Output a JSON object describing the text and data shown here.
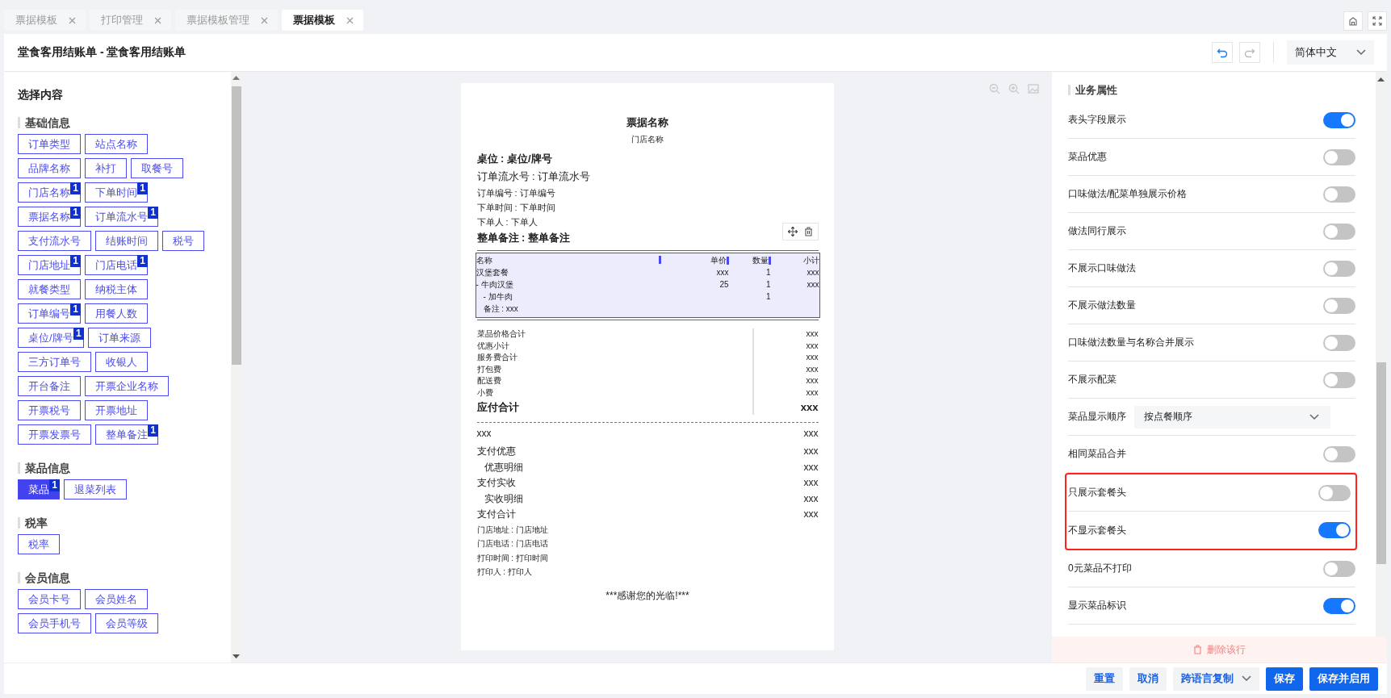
{
  "tabs": [
    {
      "label": "票据模板",
      "selected": false
    },
    {
      "label": "打印管理",
      "selected": false
    },
    {
      "label": "票据模板管理",
      "selected": false
    },
    {
      "label": "票据模板",
      "selected": true
    }
  ],
  "header": {
    "title": "堂食客用结账单 - 堂食客用结账单",
    "language": "简体中文"
  },
  "content_panel": {
    "title": "选择内容",
    "groups": [
      {
        "title": "基础信息",
        "tags": [
          {
            "label": "订单类型",
            "selected": false
          },
          {
            "label": "站点名称",
            "selected": false
          },
          {
            "label": "品牌名称",
            "selected": false
          },
          {
            "label": "补打",
            "selected": false
          },
          {
            "label": "取餐号",
            "selected": false
          },
          {
            "label": "门店名称",
            "badge": "1",
            "selected": false
          },
          {
            "label": "下单时间",
            "badge": "1",
            "selected": false
          },
          {
            "label": "票据名称",
            "badge": "1",
            "selected": false
          },
          {
            "label": "订单流水号",
            "badge": "1",
            "selected": false
          },
          {
            "label": "支付流水号",
            "selected": false
          },
          {
            "label": "结账时间",
            "selected": false
          },
          {
            "label": "税号",
            "selected": false
          },
          {
            "label": "门店地址",
            "badge": "1",
            "selected": false
          },
          {
            "label": "门店电话",
            "badge": "1",
            "selected": false
          },
          {
            "label": "就餐类型",
            "selected": false
          },
          {
            "label": "纳税主体",
            "selected": false
          },
          {
            "label": "订单编号",
            "badge": "1",
            "selected": false
          },
          {
            "label": "用餐人数",
            "selected": false
          },
          {
            "label": "桌位/牌号",
            "badge": "1",
            "selected": false
          },
          {
            "label": "订单来源",
            "selected": false
          },
          {
            "label": "三方订单号",
            "selected": false
          },
          {
            "label": "收银人",
            "selected": false
          },
          {
            "label": "开台备注",
            "selected": false
          },
          {
            "label": "开票企业名称",
            "selected": false
          },
          {
            "label": "开票税号",
            "selected": false
          },
          {
            "label": "开票地址",
            "selected": false
          },
          {
            "label": "开票发票号",
            "selected": false
          },
          {
            "label": "整单备注",
            "badge": "1",
            "selected": false
          }
        ]
      },
      {
        "title": "菜品信息",
        "tags": [
          {
            "label": "菜品",
            "badge": "1",
            "selected": true
          },
          {
            "label": "退菜列表",
            "selected": false
          }
        ]
      },
      {
        "title": "税率",
        "tags": [
          {
            "label": "税率",
            "selected": false
          }
        ]
      },
      {
        "title": "会员信息",
        "tags": [
          {
            "label": "会员卡号",
            "selected": false
          },
          {
            "label": "会员姓名",
            "selected": false
          },
          {
            "label": "会员手机号",
            "selected": false
          },
          {
            "label": "会员等级",
            "selected": false
          }
        ]
      }
    ]
  },
  "receipt": {
    "title": "票据名称",
    "store": "门店名称",
    "head_lines": [
      {
        "text": "桌位 : 桌位/牌号",
        "kind": "bold"
      },
      {
        "text": "订单流水号 : 订单流水号",
        "kind": "large"
      },
      {
        "text": "订单编号 : 订单编号",
        "kind": "small"
      },
      {
        "text": "下单时间 : 下单时间",
        "kind": "small"
      },
      {
        "text": "下单人 : 下单人",
        "kind": "small"
      },
      {
        "text": "整单备注 : 整单备注",
        "kind": "bold"
      }
    ],
    "items_table": {
      "selected": true,
      "columns": [
        "名称",
        "单价",
        "数量",
        "小计"
      ],
      "rows": [
        {
          "name": "汉堡套餐",
          "price": "xxx",
          "qty": "1",
          "subtotal": "xxx"
        },
        {
          "name": "- 牛肉汉堡",
          "price": "25",
          "qty": "1",
          "subtotal": "xxx",
          "children": [
            {
              "name": "- 加牛肉",
              "qty": "1"
            },
            {
              "name": "备注 : xxx"
            }
          ]
        }
      ]
    },
    "totals": [
      {
        "label": "菜品价格合计",
        "value": "xxx",
        "bold": false
      },
      {
        "label": "优惠小计",
        "value": "xxx",
        "bold": false
      },
      {
        "label": "服务费合计",
        "value": "xxx",
        "bold": false
      },
      {
        "label": "打包费",
        "value": "xxx",
        "bold": false
      },
      {
        "label": "配送费",
        "value": "xxx",
        "bold": false
      },
      {
        "label": "小费",
        "value": "xxx",
        "bold": false
      },
      {
        "label": "应付合计",
        "value": "xxx",
        "bold": true
      }
    ],
    "payments": [
      {
        "label": "xxx",
        "value": "xxx"
      },
      {
        "label": "支付优惠",
        "value": "xxx",
        "children": [
          {
            "label": "优惠明细",
            "value": "xxx"
          }
        ]
      },
      {
        "label": "支付实收",
        "value": "xxx",
        "children": [
          {
            "label": "实收明细",
            "value": "xxx"
          }
        ]
      },
      {
        "label": "支付合计",
        "value": "xxx"
      }
    ],
    "footer_lines": [
      "门店地址 : 门店地址",
      "门店电话 : 门店电话",
      "打印时间 : 打印时间",
      "打印人 : 打印人"
    ],
    "thanks": "***感谢您的光临!***"
  },
  "properties": {
    "title": "业务属性",
    "settings": [
      {
        "kind": "toggle",
        "label": "表头字段展示",
        "on": true,
        "highlighted": false
      },
      {
        "kind": "toggle",
        "label": "菜品优惠",
        "on": false,
        "highlighted": false
      },
      {
        "kind": "toggle",
        "label": "口味做法/配菜单独展示价格",
        "on": false,
        "highlighted": false
      },
      {
        "kind": "toggle",
        "label": "做法同行展示",
        "on": false,
        "highlighted": false
      },
      {
        "kind": "toggle",
        "label": "不展示口味做法",
        "on": false,
        "highlighted": false
      },
      {
        "kind": "toggle",
        "label": "不展示做法数量",
        "on": false,
        "highlighted": false
      },
      {
        "kind": "toggle",
        "label": "口味做法数量与名称合并展示",
        "on": false,
        "highlighted": false
      },
      {
        "kind": "toggle",
        "label": "不展示配菜",
        "on": false,
        "highlighted": false
      },
      {
        "kind": "select",
        "label": "菜品显示顺序",
        "value": "按点餐顺序",
        "highlighted": false
      },
      {
        "kind": "toggle",
        "label": "相同菜品合并",
        "on": false,
        "highlighted": false
      },
      {
        "kind": "toggle",
        "label": "只展示套餐头",
        "on": false,
        "highlighted": true
      },
      {
        "kind": "toggle",
        "label": "不显示套餐头",
        "on": true,
        "highlighted": true
      },
      {
        "kind": "toggle",
        "label": "0元菜品不打印",
        "on": false,
        "highlighted": false
      },
      {
        "kind": "toggle",
        "label": "显示菜品标识",
        "on": true,
        "highlighted": false
      }
    ],
    "delete_label": "删除该行"
  },
  "footer_buttons": [
    {
      "label": "重置",
      "kind": "secondary"
    },
    {
      "label": "取消",
      "kind": "secondary"
    },
    {
      "label": "跨语言复制",
      "kind": "dropdown"
    },
    {
      "label": "保存",
      "kind": "primary"
    },
    {
      "label": "保存并启用",
      "kind": "primary"
    }
  ]
}
